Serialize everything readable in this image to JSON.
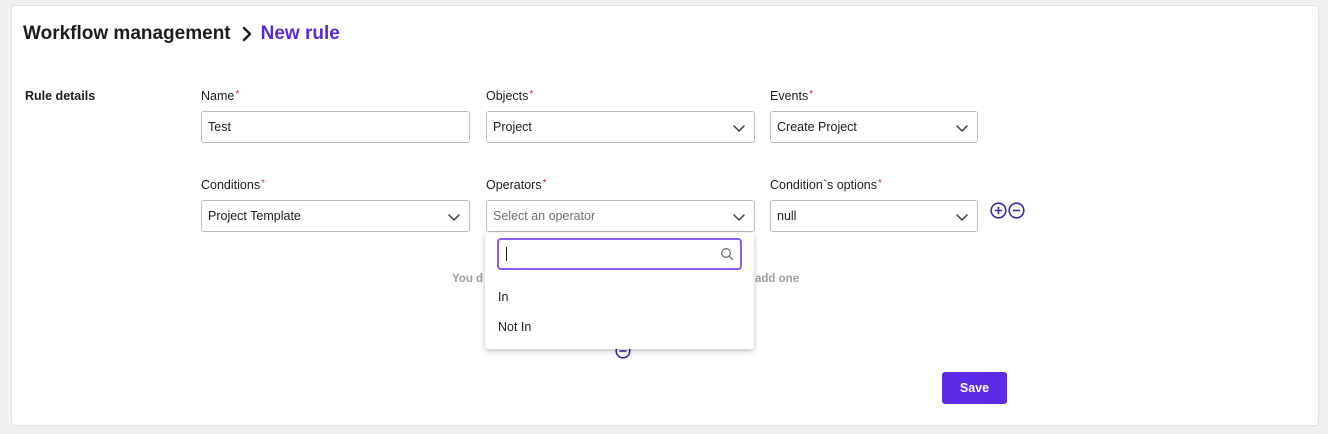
{
  "breadcrumb": {
    "root": "Workflow management",
    "current": "New rule"
  },
  "section": {
    "title": "Rule details"
  },
  "fields": {
    "name": {
      "label": "Name",
      "value": "Test"
    },
    "objects": {
      "label": "Objects",
      "value": "Project"
    },
    "events": {
      "label": "Events",
      "value": "Create Project"
    },
    "conditions": {
      "label": "Conditions",
      "value": "Project Template"
    },
    "operators": {
      "label": "Operators",
      "placeholder": "Select an operator"
    },
    "condition_options": {
      "label": "Condition`s options",
      "value": "null"
    }
  },
  "required_marker": "*",
  "empty_state": {
    "left_fragment": "You d",
    "right_fragment": "add one"
  },
  "operator_dropdown": {
    "search_value": "",
    "options": [
      "In",
      "Not In"
    ]
  },
  "actions": {
    "save_label": "Save"
  },
  "icons": {
    "breadcrumb_separator": "chevron-right-icon",
    "select_arrow": "chevron-down-icon",
    "add": "plus-circle-icon",
    "remove": "minus-circle-icon",
    "search": "search-icon"
  },
  "colors": {
    "accent": "#5b2ad6",
    "primary_button": "#5b2be8",
    "required": "#d92020",
    "focus_border": "#8c5cf0",
    "muted_text": "#9a9ea5"
  }
}
